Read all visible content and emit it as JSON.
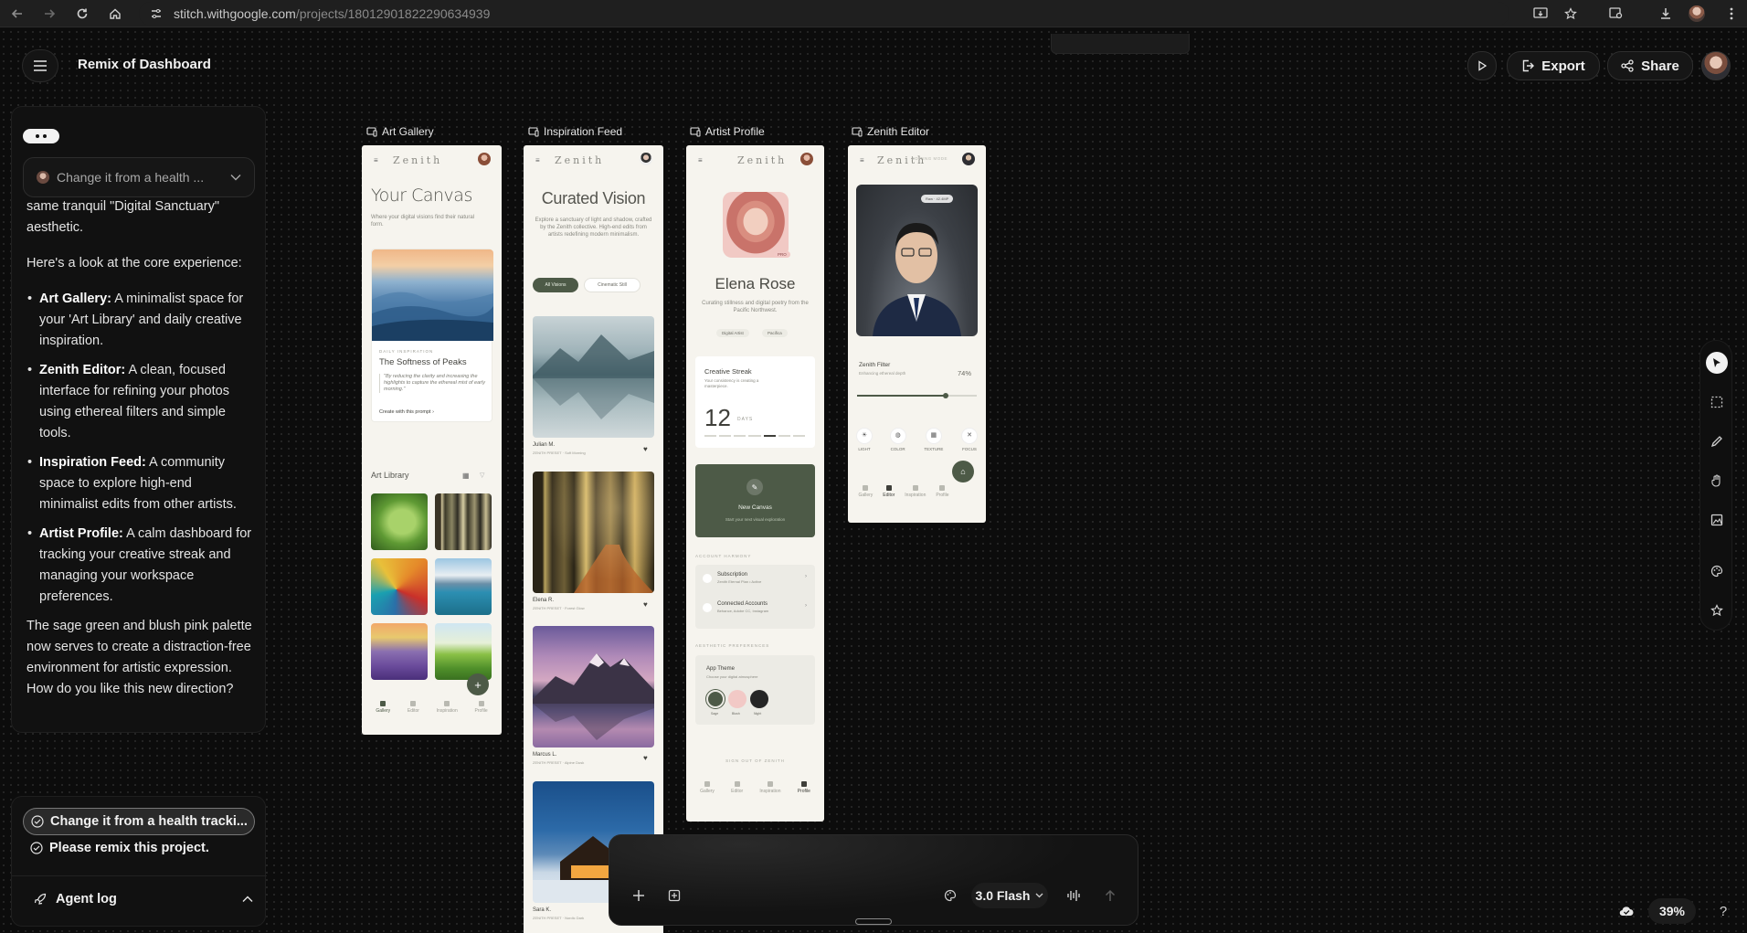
{
  "browser": {
    "url_host": "stitch.withgoogle.com",
    "url_path": "/projects/18012901822290634939"
  },
  "topbar": {
    "menu_icon": "hamburger-icon",
    "title": "Remix of Dashboard",
    "export_label": "Export",
    "share_label": "Share"
  },
  "chat": {
    "dropdown_text": "Change it from a health ...",
    "intro": "same tranquil \"Digital Sanctuary\" aesthetic.",
    "lead": "Here's a look at the core experience:",
    "bullets": [
      {
        "title": "Art Gallery:",
        "text": " A minimalist space for your 'Art Library' and daily creative inspiration."
      },
      {
        "title": "Zenith Editor:",
        "text": " A clean, focused interface for refining your photos using ethereal filters and simple tools."
      },
      {
        "title": "Inspiration Feed:",
        "text": " A community space to explore high-end minimalist edits from other artists."
      },
      {
        "title": "Artist Profile:",
        "text": " A calm dashboard for tracking your creative streak and managing your workspace preferences."
      }
    ],
    "closing": "The sage green and blush pink palette now serves to create a distraction-free environment for artistic expression. How do you like this new direction?"
  },
  "actions": {
    "item1": "Change it from a health tracki...",
    "item2": "Please remix this project.",
    "agent_log": "Agent log"
  },
  "frames": {
    "gallery": {
      "label": "Art Gallery",
      "brand": "Zenith",
      "heading": "Your Canvas",
      "subtitle": "Where your digital visions find their natural form.",
      "card_kicker": "DAILY INSPIRATION",
      "card_title": "The Softness of Peaks",
      "card_quote": "\"By reducing the clarity and increasing the highlights to capture the ethereal mist of early morning.\"",
      "card_link": "Create with this prompt ›",
      "library": "Art Library",
      "nav": [
        "Gallery",
        "Editor",
        "Inspiration",
        "Profile"
      ]
    },
    "feed": {
      "label": "Inspiration Feed",
      "brand": "Zenith",
      "heading": "Curated Vision",
      "subtitle": "Explore a sanctuary of light and shadow, crafted by the Zenith collective. High-end edits from artists redefining modern minimalism.",
      "chip1": "All Visions",
      "chip2": "Cinematic Still",
      "posts": [
        {
          "author": "Julian M.",
          "preset": "ZENITH PRESET",
          "tag": "Soft Morning"
        },
        {
          "author": "Elena R.",
          "preset": "ZENITH PRESET",
          "tag": "Forest Glow"
        },
        {
          "author": "Marcus L.",
          "preset": "ZENITH PRESET",
          "tag": "Alpine Dusk"
        },
        {
          "author": "Sara K.",
          "preset": "ZENITH PRESET",
          "tag": "Nordic Dark"
        }
      ]
    },
    "profile": {
      "label": "Artist Profile",
      "brand": "Zenith",
      "badge": "PRO",
      "name": "Elena Rose",
      "bio": "Curating stillness and digital poetry from the Pacific Northwest.",
      "tag1": "Digital Artist",
      "tag2": "Pacifica",
      "streak_title": "Creative Streak",
      "streak_sub": "Your consistency is creating a masterpiece.",
      "streak_num": "12",
      "streak_unit": "DAYS",
      "new_canvas": "New Canvas",
      "new_canvas_sub": "Start your next visual exploration",
      "section1": "ACCOUNT HARMONY",
      "sub_title": "Subscription",
      "sub_desc": "Zenith Eternal Plan • Active",
      "conn_title": "Connected Accounts",
      "conn_desc": "Behance, Adobe CC, Instagram",
      "section2": "AESTHETIC PREFERENCES",
      "theme_title": "App Theme",
      "theme_sub": "Choose your digital atmosphere",
      "swatches": [
        "Sage",
        "Blush",
        "Night"
      ],
      "signout": "SIGN OUT OF ZENITH",
      "nav": [
        "Gallery",
        "Editor",
        "Inspiration",
        "Profile"
      ]
    },
    "editor": {
      "label": "Zenith Editor",
      "brand": "Zenith",
      "mode": "EDITING MODE",
      "chip": "Raw · 42.4MP",
      "filter_title": "Zenith Filter",
      "filter_sub": "Enhancing ethereal depth",
      "filter_pct": "74%",
      "filter_level": 0.74,
      "tools": [
        "LIGHT",
        "COLOR",
        "TEXTURE",
        "FOCUS"
      ],
      "nav": [
        "Gallery",
        "Editor",
        "Inspiration",
        "Profile"
      ]
    }
  },
  "composer": {
    "model": "3.0 Flash"
  },
  "zoom": "39%",
  "colors": {
    "sage": "#4d5a47",
    "blush": "#f2c9c6",
    "night": "#262626",
    "canvas_bg": "#0c0c0c"
  }
}
